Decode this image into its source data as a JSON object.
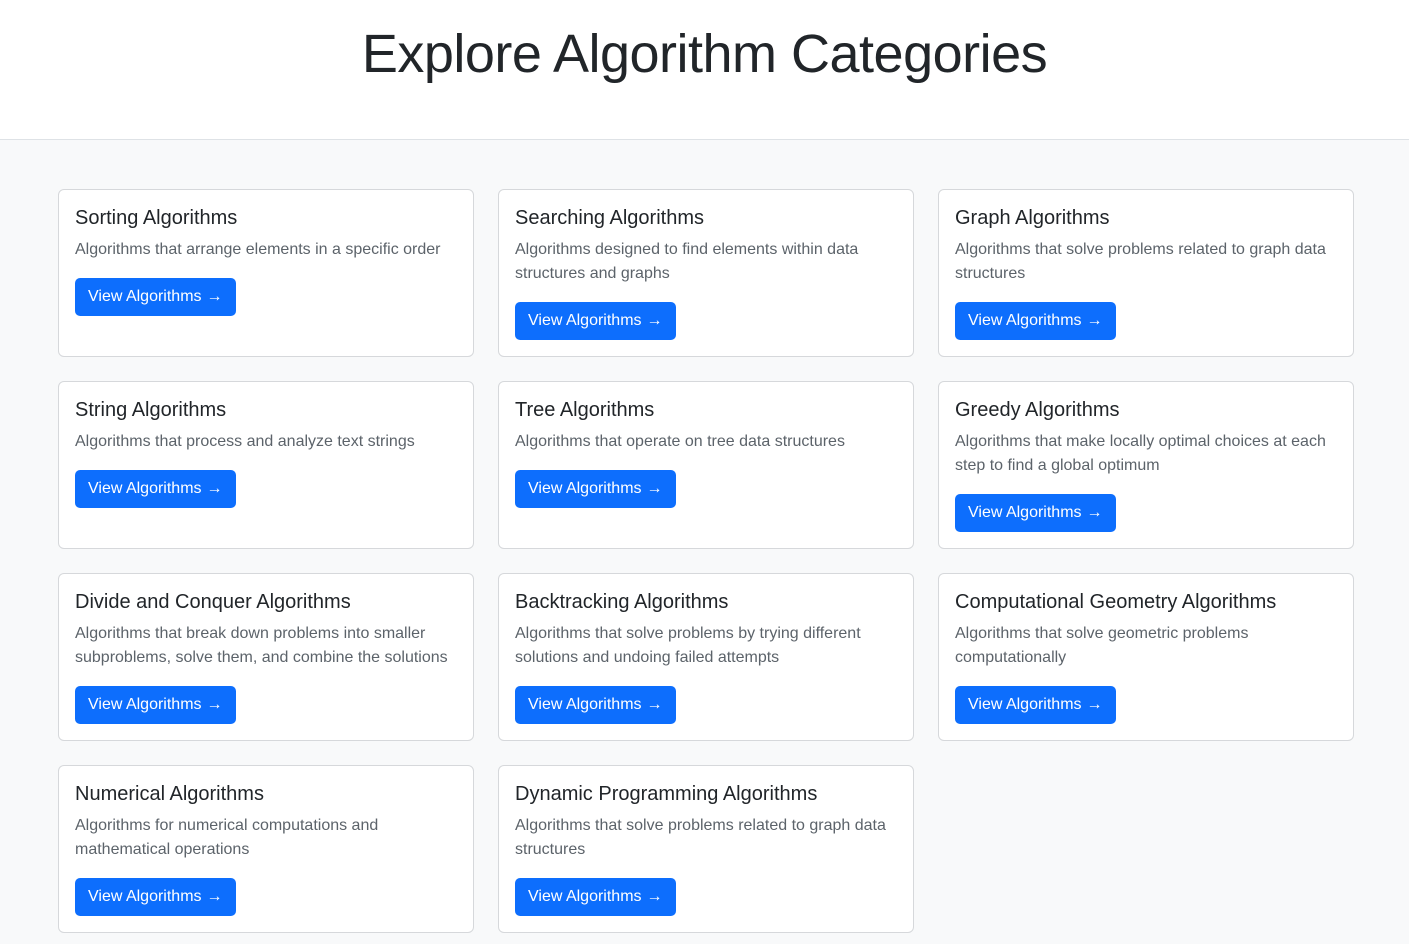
{
  "header": {
    "title": "Explore Algorithm Categories"
  },
  "button_label": "View Algorithms",
  "arrow_glyph": "→",
  "categories": [
    {
      "title": "Sorting Algorithms",
      "description": "Algorithms that arrange elements in a specific order"
    },
    {
      "title": "Searching Algorithms",
      "description": "Algorithms designed to find elements within data structures and graphs"
    },
    {
      "title": "Graph Algorithms",
      "description": "Algorithms that solve problems related to graph data structures"
    },
    {
      "title": "String Algorithms",
      "description": "Algorithms that process and analyze text strings"
    },
    {
      "title": "Tree Algorithms",
      "description": "Algorithms that operate on tree data structures"
    },
    {
      "title": "Greedy Algorithms",
      "description": "Algorithms that make locally optimal choices at each step to find a global optimum"
    },
    {
      "title": "Divide and Conquer Algorithms",
      "description": "Algorithms that break down problems into smaller subproblems, solve them, and combine the solutions"
    },
    {
      "title": "Backtracking Algorithms",
      "description": "Algorithms that solve problems by trying different solutions and undoing failed attempts"
    },
    {
      "title": "Computational Geometry Algorithms",
      "description": "Algorithms that solve geometric problems computationally"
    },
    {
      "title": "Numerical Algorithms",
      "description": "Algorithms for numerical computations and mathematical operations"
    },
    {
      "title": "Dynamic Programming Algorithms",
      "description": "Algorithms that solve problems related to graph data structures"
    }
  ],
  "colors": {
    "primary": "#0d6efd",
    "background": "#f8f9fa",
    "card_border": "#d6d8db",
    "text_muted": "#5c636a"
  }
}
